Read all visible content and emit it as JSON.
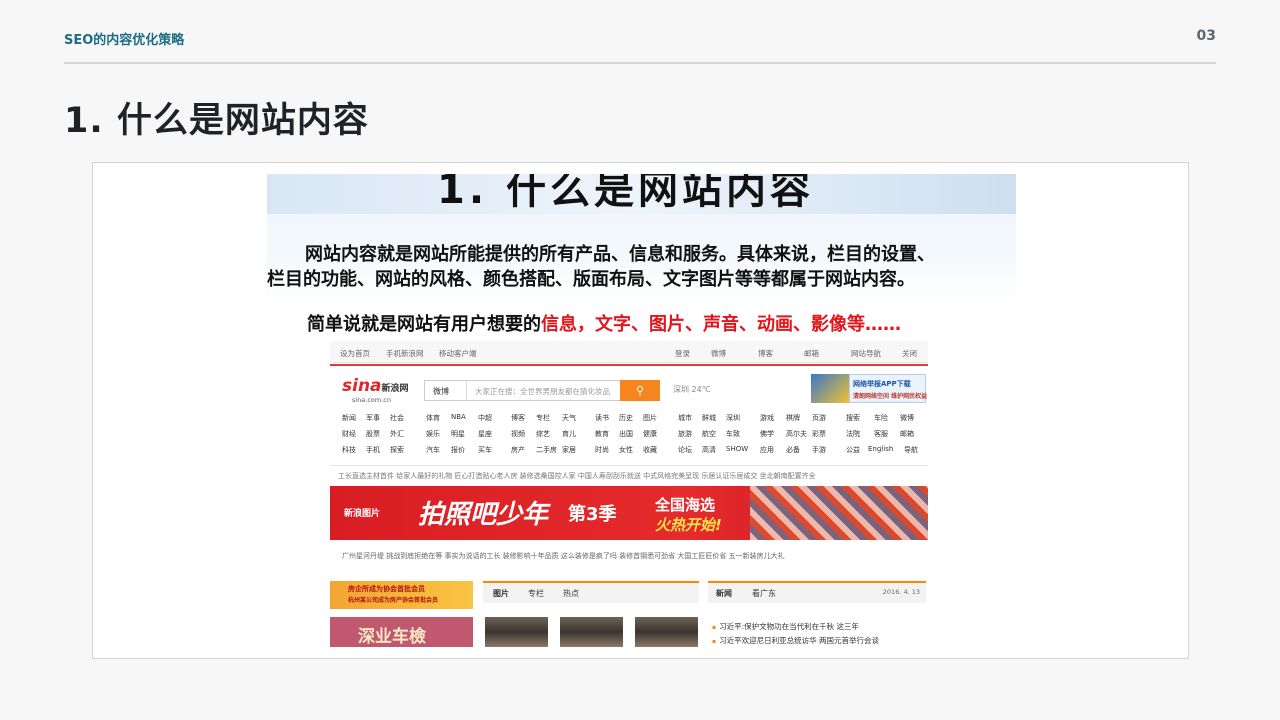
{
  "header": {
    "section_title": "SEO的内容优化策略",
    "page_number": "03"
  },
  "main_title": "1. 什么是网站内容",
  "image": {
    "inner_title": "1. 什么是网站内容",
    "definition_line1": "网站内容就是网站所能提供的所有产品、信息和服务。具体来说，栏目的设置、",
    "definition_line2": "栏目的功能、网站的风格、颜色搭配、版面布局、文字图片等等都属于网站内容。",
    "simple_prefix": "简单说就是网站有用户想要的",
    "simple_highlight": "信息，文字、图片、声音、动画、影像等……",
    "colors": {
      "highlight": "#e3141b",
      "accent": "#1d6b86"
    }
  },
  "sina": {
    "topbar": [
      "设为首页",
      "手机新浪网",
      "移动客户端",
      "登录",
      "微博",
      "博客",
      "邮箱",
      "网站导航",
      "关闭"
    ],
    "logo": "sina",
    "logo_cn": "新浪网",
    "logo_url": "sina.com.cn",
    "search_select": "微博",
    "search_placeholder": "大家正在搜：全世界男朋友都在猜化妆品",
    "weather": "深圳  24℃",
    "ad_right_1": "网络举报APP下载",
    "ad_right_2": "清朗网络空间 维护网民权益",
    "nav_rows": [
      [
        "新闻",
        "军事",
        "社会",
        "体育",
        "NBA",
        "中超",
        "博客",
        "专栏",
        "天气",
        "读书",
        "历史",
        "图片",
        "城市",
        "鲜城",
        "深圳",
        "游戏",
        "棋牌",
        "页游",
        "搜索",
        "车险",
        "微博"
      ],
      [
        "财经",
        "股票",
        "外汇",
        "娱乐",
        "明星",
        "星座",
        "视频",
        "综艺",
        "育儿",
        "教育",
        "出国",
        "健康",
        "旅游",
        "航空",
        "车致",
        "佛学",
        "高尔夫",
        "彩票",
        "法院",
        "客服",
        "邮箱"
      ],
      [
        "科技",
        "手机",
        "探索",
        "汽车",
        "报价",
        "买车",
        "房产",
        "二手房",
        "家居",
        "时尚",
        "女性",
        "收藏",
        "论坛",
        "高清",
        "SHOW",
        "应用",
        "必备",
        "手游",
        "公益",
        "English",
        "导航"
      ]
    ],
    "news_row_1": "工长直选主材首件   给家人最好的礼物   匠心打造贴心老人房   装修选桑国控人家   中国人寿刮刮乐就送   中式风格完美呈现   乐居认证乐居成交   坐北朝南配置齐全",
    "banner_brand": "新浪图片",
    "banner_campaign": "拍照吧少年",
    "banner_season": "第3季",
    "banner_cta_1": "全国海选",
    "banner_cta_2": "火热开始!",
    "news_row_2": "广州星河丹堤   挑战到底拒绝在等   事实为说话的工长   装修影响十年品质   这么装修是疯了吗   装修首钢悉可劲省   大国工匠匠价省   五一新装房儿大礼",
    "ad_left_1": "房企所成为协会首批会员",
    "ad_left_2": "杭州某公司成为房产协会首批会员",
    "ad_left_3": "深业车檢",
    "photo_tabs": [
      "图片",
      "专栏",
      "热点"
    ],
    "news_tabs": [
      "新闻",
      "看广东"
    ],
    "news_date": "2016. 4. 13",
    "headlines": [
      "习近平:保护文物功在当代利在千秋 这三年",
      "习近平欢迎尼日利亚总统访华 两国元首举行会谈"
    ]
  }
}
